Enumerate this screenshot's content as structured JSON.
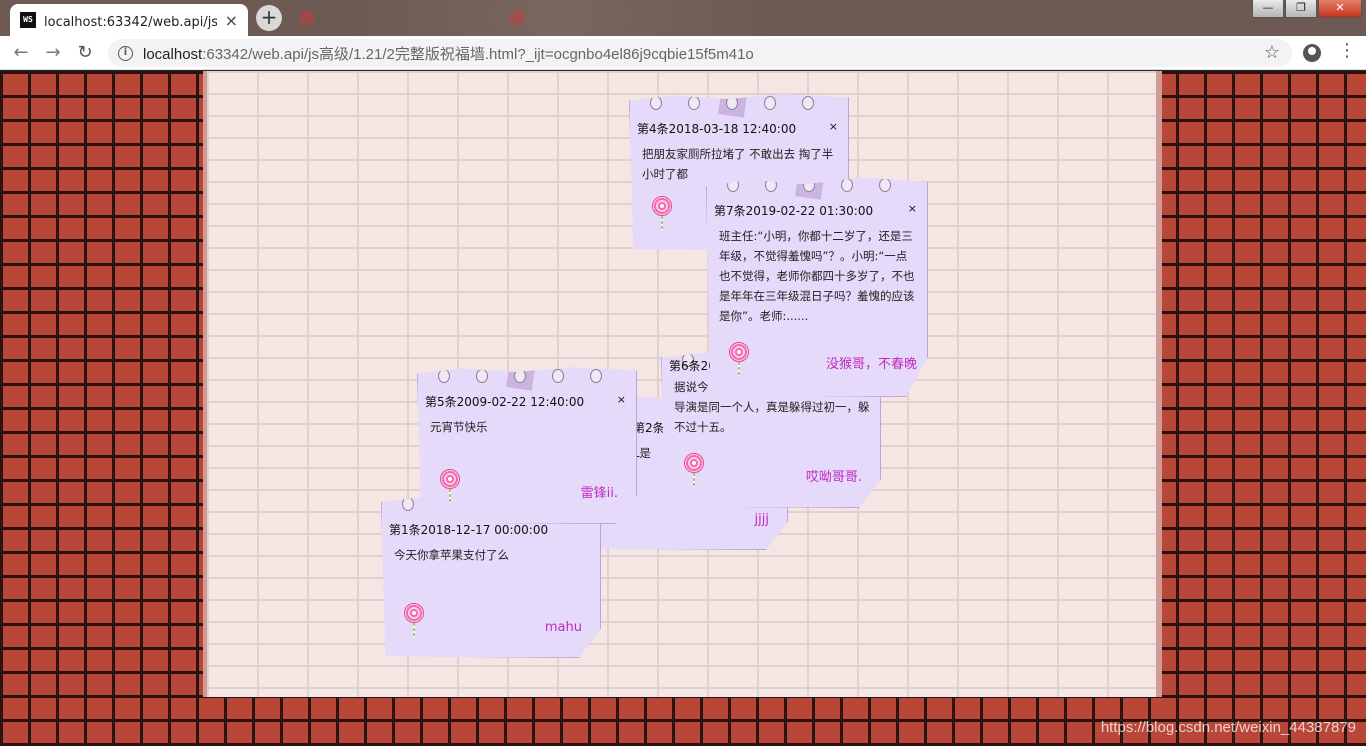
{
  "browser": {
    "tab_title": "localhost:63342/web.api/js高级",
    "tab_favicon": "WS",
    "url_host": "localhost",
    "url_rest": ":63342/web.api/js高级/1.21/2完整版祝福墙.html?_ijt=ocgnbo4el86j9cqbie15f5m41o",
    "close_symbol": "×",
    "new_tab_symbol": "+"
  },
  "notes": [
    {
      "id": "note-4",
      "header": "第4条2018-03-18 12:40:00",
      "close": "×",
      "body": "把朋友家厕所拉堵了 不敢出去 掏了半小时了都",
      "author": ""
    },
    {
      "id": "note-7",
      "header": "第7条2019-02-22 01:30:00",
      "close": "×",
      "body": "班主任:“小明，你都十二岁了，还是三年级，不觉得羞愧吗”？。小明:“一点也不觉得，老师你都四十多岁了，不也是年年在三年级混日子吗？羞愧的应该是你”。老师:......",
      "author": "没猴哥，不春晚"
    },
    {
      "id": "note-6",
      "header": "第6条2019",
      "close": "×",
      "body": "据说今年春晚导演是同一个人，真是躲得过初一，躲不过十五。",
      "body_visible": "据说今",
      "body_rest": "导演是同一个人，真是躲得过初一，躲不过十五。",
      "author": "哎呦哥哥."
    },
    {
      "id": "note-2",
      "header": "第2条2019-01-1",
      "close": "×",
      "body": "我是",
      "body_visible": "L是",
      "author": "jjjj"
    },
    {
      "id": "note-5",
      "header": "第5条2009-02-22 12:40:00",
      "close": "×",
      "body": "元宵节快乐",
      "author": "雷锋ii."
    },
    {
      "id": "note-1",
      "header": "第1条2018-12-17 00:00:00",
      "close": "×",
      "body": "今天你拿苹果支付了么",
      "author": "mahu"
    }
  ],
  "watermark": "https://blog.csdn.net/weixin_44387879",
  "colors": {
    "note_bg": "#e6dafa",
    "author": "#c02bbf",
    "brick": "#b8473a",
    "wall": "#f5e6e4"
  }
}
